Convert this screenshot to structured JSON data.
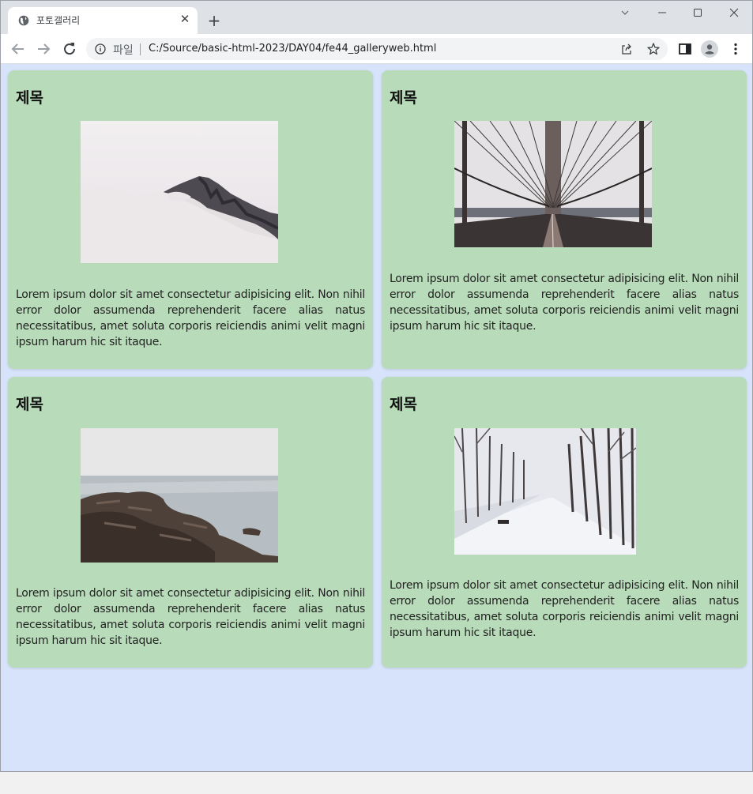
{
  "browser": {
    "tab_title": "포토갤러리",
    "address_scheme": "파일",
    "address_url": "C:/Source/basic-html-2023/DAY04/fe44_galleryweb.html"
  },
  "cards": [
    {
      "title": "제목",
      "image": "mountain-in-fog",
      "text": "Lorem ipsum dolor sit amet consectetur adipisicing elit. Non nihil error dolor assumenda reprehenderit facere alias natus necessitatibus, amet soluta corporis reiciendis animi velit magni ipsum harum hic sit itaque."
    },
    {
      "title": "제목",
      "image": "suspension-bridge",
      "text": "Lorem ipsum dolor sit amet consectetur adipisicing elit. Non nihil error dolor assumenda reprehenderit facere alias natus necessitatibus, amet soluta corporis reiciendis animi velit magni ipsum harum hic sit itaque."
    },
    {
      "title": "제목",
      "image": "rocky-shore",
      "text": "Lorem ipsum dolor sit amet consectetur adipisicing elit. Non nihil error dolor assumenda reprehenderit facere alias natus necessitatibus, amet soluta corporis reiciendis animi velit magni ipsum harum hic sit itaque."
    },
    {
      "title": "제목",
      "image": "snowy-path",
      "text": "Lorem ipsum dolor sit amet consectetur adipisicing elit. Non nihil error dolor assumenda reprehenderit facere alias natus necessitatibus, amet soluta corporis reiciendis animi velit magni ipsum harum hic sit itaque."
    }
  ],
  "colors": {
    "page_background": "#d7e3fa",
    "card_background": "#b8dbb9"
  }
}
